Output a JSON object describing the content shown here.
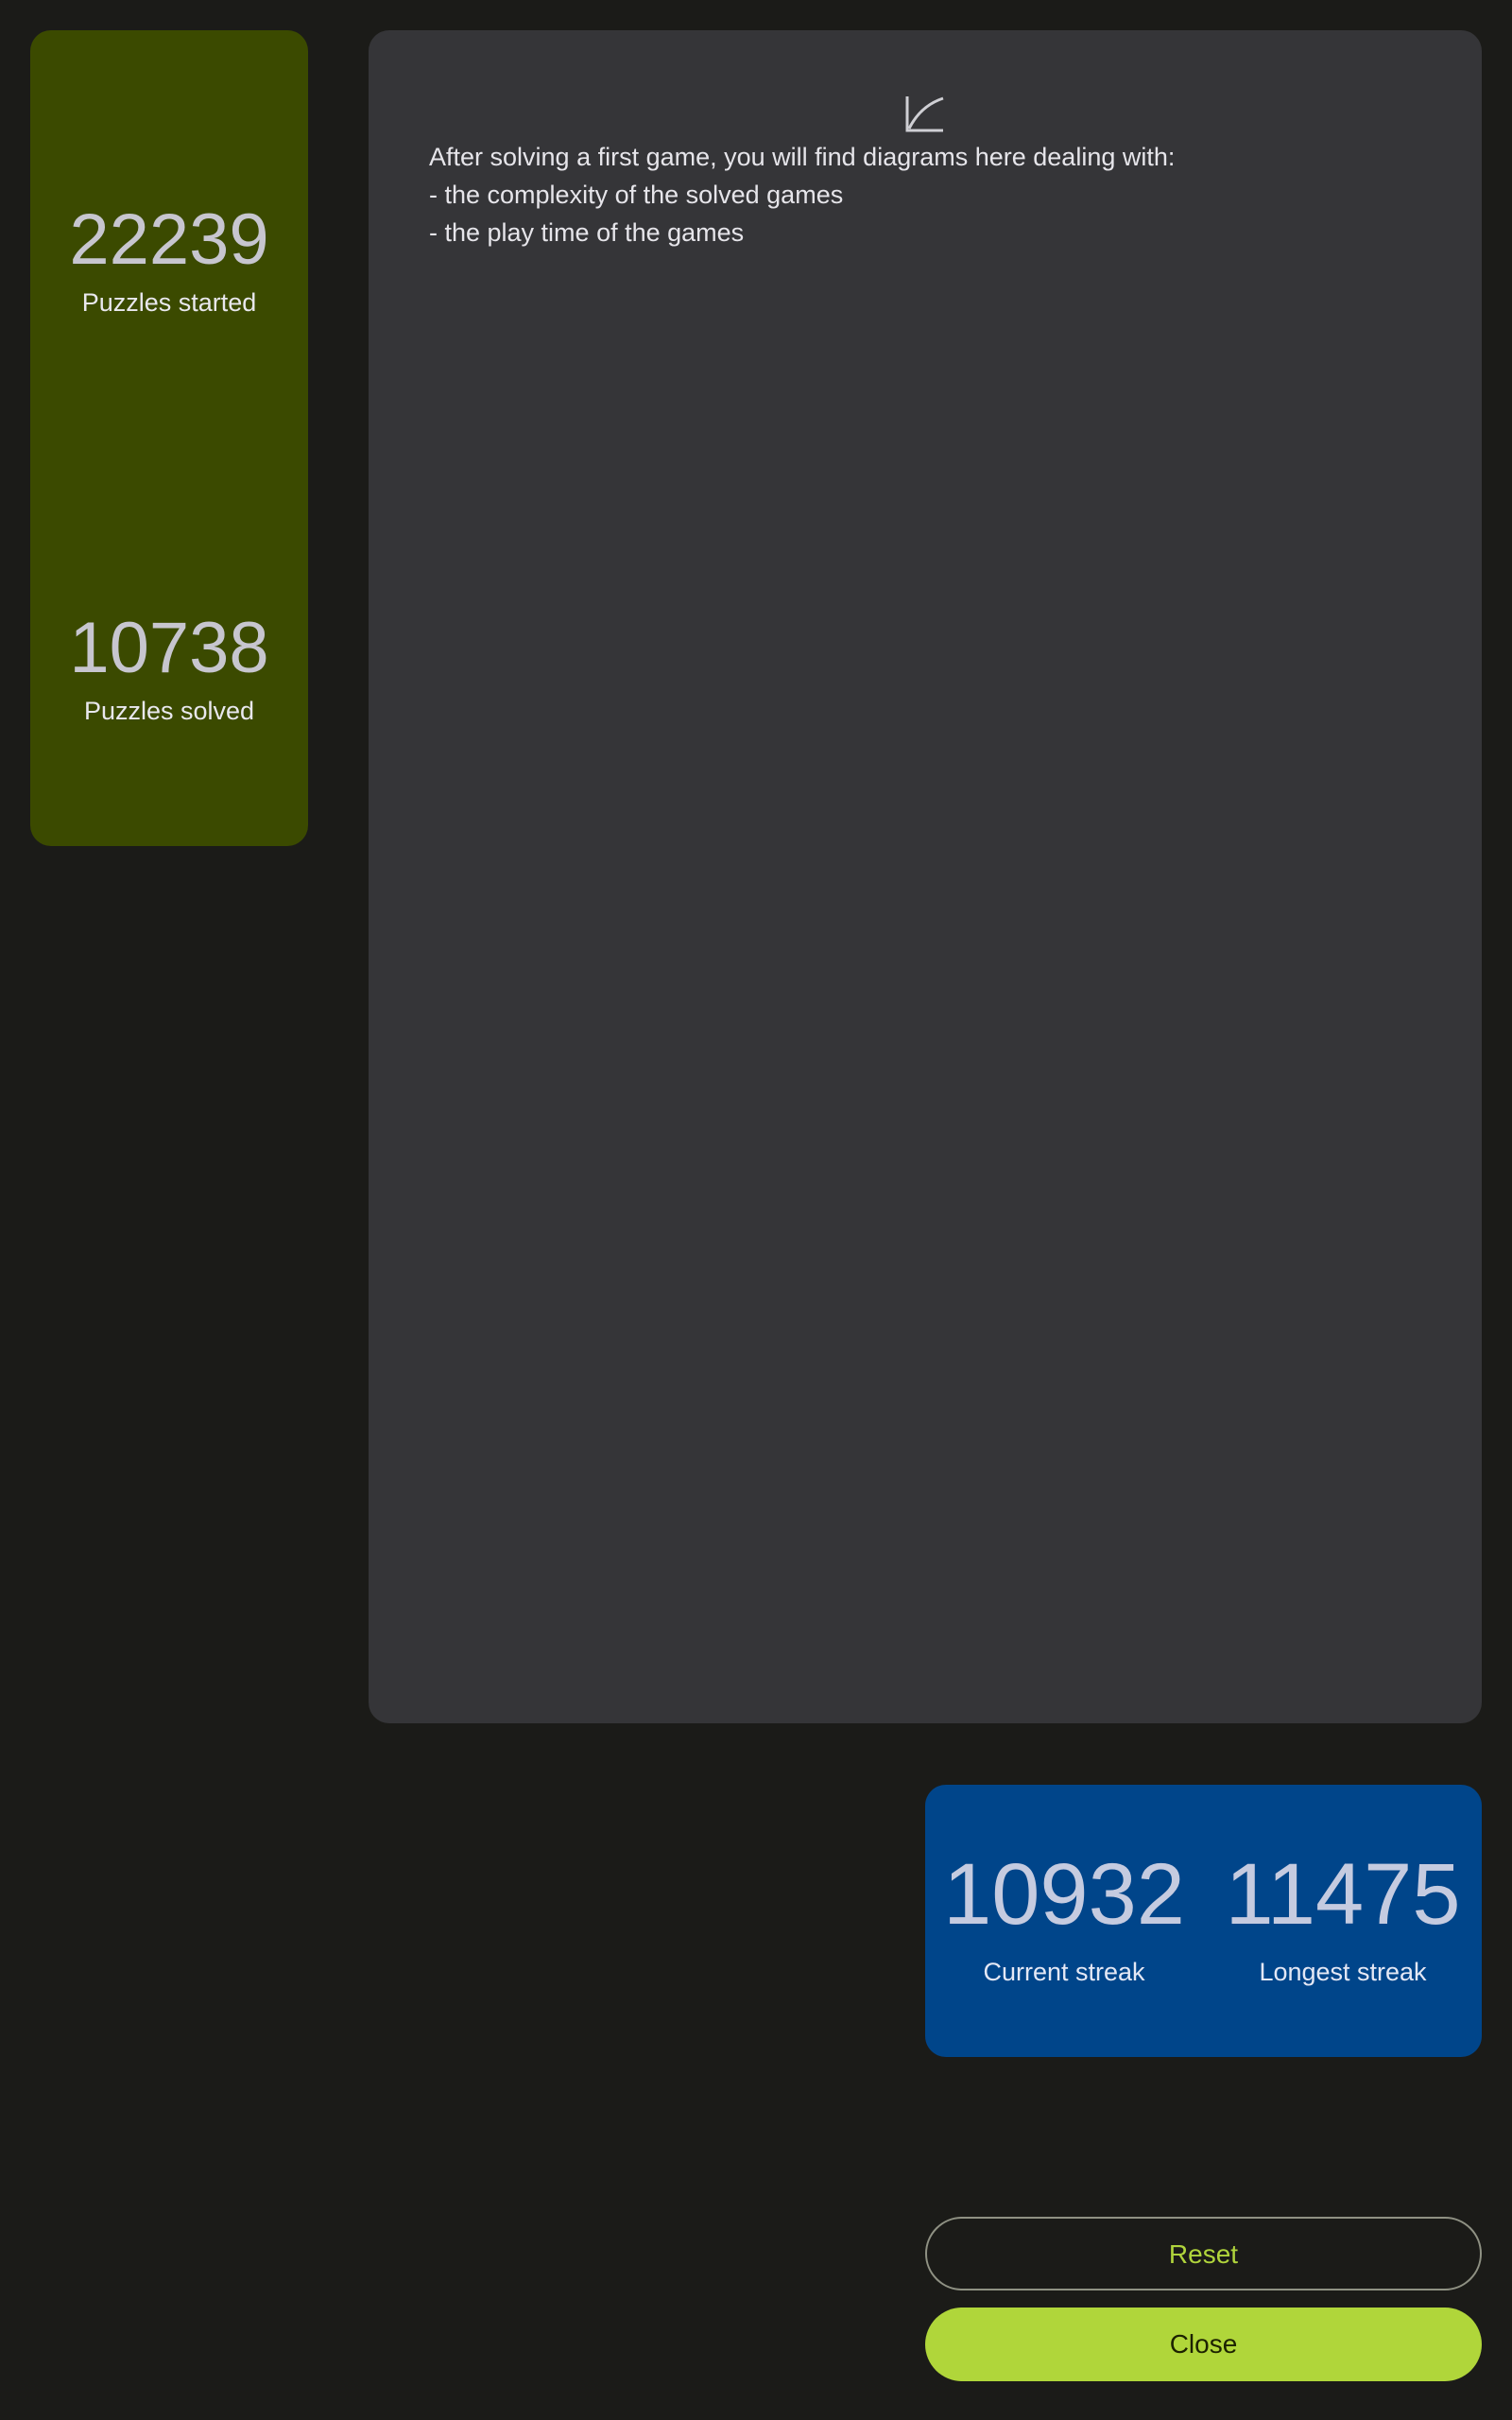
{
  "stats": {
    "started": {
      "value": "22239",
      "label": "Puzzles started"
    },
    "solved": {
      "value": "10738",
      "label": "Puzzles solved"
    }
  },
  "diagram": {
    "icon": "chart-icon",
    "intro": "After solving a first game, you will find diagrams here dealing with:",
    "items": [
      "- the complexity of the solved games",
      "- the play time of the games"
    ]
  },
  "streaks": {
    "current": {
      "value": "10932",
      "label": "Current streak"
    },
    "longest": {
      "value": "11475",
      "label": "Longest streak"
    }
  },
  "buttons": {
    "reset_label": "Reset",
    "close_label": "Close"
  },
  "colors": {
    "background": "#1b1b18",
    "stats_panel": "#3b4a00",
    "diagram_panel": "#353538",
    "streak_panel": "#00458a",
    "accent": "#b0d63a"
  }
}
